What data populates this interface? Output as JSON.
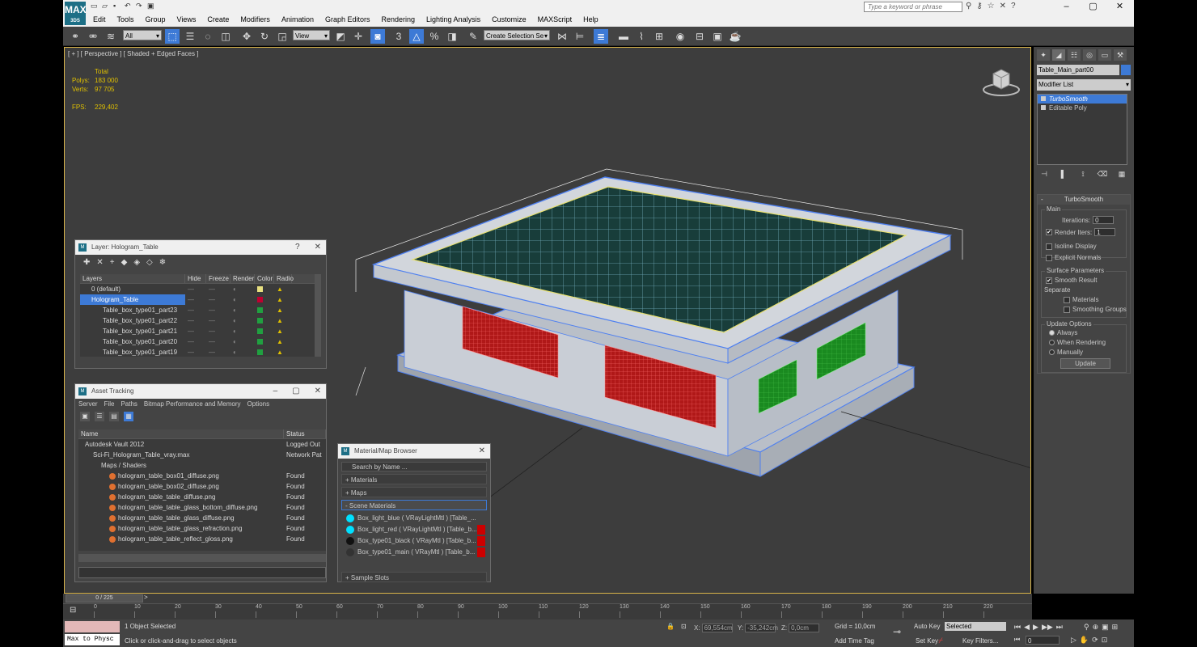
{
  "app": {
    "logo": "MAX",
    "logo_sub": "3DS"
  },
  "menu": [
    "Edit",
    "Tools",
    "Group",
    "Views",
    "Create",
    "Modifiers",
    "Animation",
    "Graph Editors",
    "Rendering",
    "Lighting Analysis",
    "Customize",
    "MAXScript",
    "Help"
  ],
  "search": {
    "placeholder": "Type a keyword or phrase"
  },
  "toolbar": {
    "filter": "All",
    "refcoord": "View",
    "selset": "Create Selection Se"
  },
  "viewport": {
    "label": "[ + ] [ Perspective ] [ Shaded + Edged Faces ]",
    "stats_header": "Total",
    "polys_label": "Polys:",
    "polys": "183 000",
    "verts_label": "Verts:",
    "verts": "97 705",
    "fps_label": "FPS:",
    "fps": "229,402"
  },
  "cmdpanel": {
    "object_name": "Table_Main_part00",
    "modifier_list": "Modifier List",
    "stack": [
      "TurboSmooth",
      "Editable Poly"
    ],
    "rollout_title": "TurboSmooth",
    "main_group": "Main",
    "iterations_label": "Iterations:",
    "iterations": "0",
    "render_iters_label": "Render Iters:",
    "render_iters": "1",
    "isoline": "Isoline Display",
    "explicit_normals": "Explicit Normals",
    "surface_group": "Surface Parameters",
    "smooth_result": "Smooth Result",
    "separate": "Separate",
    "materials": "Materials",
    "smoothing_groups": "Smoothing Groups",
    "update_group": "Update Options",
    "always": "Always",
    "when_rendering": "When Rendering",
    "manually": "Manually",
    "update_btn": "Update"
  },
  "layer_window": {
    "title": "Layer: Hologram_Table",
    "columns": [
      "Layers",
      "Hide",
      "Freeze",
      "Render",
      "Color",
      "Radio"
    ],
    "rows": [
      {
        "name": "0 (default)",
        "color": "#e8e080",
        "sel": false
      },
      {
        "name": "Hologram_Table",
        "color": "#c00030",
        "sel": true
      },
      {
        "name": "Table_box_type01_part23",
        "color": "#20a040",
        "sel": false
      },
      {
        "name": "Table_box_type01_part22",
        "color": "#20a040",
        "sel": false
      },
      {
        "name": "Table_box_type01_part21",
        "color": "#20a040",
        "sel": false
      },
      {
        "name": "Table_box_type01_part20",
        "color": "#20a040",
        "sel": false
      },
      {
        "name": "Table_box_type01_part19",
        "color": "#20a040",
        "sel": false
      }
    ]
  },
  "asset_window": {
    "title": "Asset Tracking",
    "menu": [
      "Server",
      "File",
      "Paths",
      "Bitmap Performance and Memory",
      "Options"
    ],
    "columns": [
      "Name",
      "Status"
    ],
    "rows": [
      {
        "name": "Autodesk Vault 2012",
        "status": "Logged Out",
        "indent": 0
      },
      {
        "name": "Sci-Fi_Hologram_Table_vray.max",
        "status": "Network Pat",
        "indent": 1
      },
      {
        "name": "Maps / Shaders",
        "status": "",
        "indent": 2
      },
      {
        "name": "hologram_table_box01_diffuse.png",
        "status": "Found",
        "indent": 3
      },
      {
        "name": "hologram_table_box02_diffuse.png",
        "status": "Found",
        "indent": 3
      },
      {
        "name": "hologram_table_table_diffuse.png",
        "status": "Found",
        "indent": 3
      },
      {
        "name": "hologram_table_table_glass_bottom_diffuse.png",
        "status": "Found",
        "indent": 3
      },
      {
        "name": "hologram_table_table_glass_diffuse.png",
        "status": "Found",
        "indent": 3
      },
      {
        "name": "hologram_table_table_glass_refraction.png",
        "status": "Found",
        "indent": 3
      },
      {
        "name": "hologram_table_table_reflect_gloss.png",
        "status": "Found",
        "indent": 3
      }
    ]
  },
  "browser_window": {
    "title": "Material/Map Browser",
    "search": "Search by Name ...",
    "sections": [
      "+ Materials",
      "+ Maps",
      "- Scene Materials",
      "+ Sample Slots"
    ],
    "items": [
      {
        "name": "Box_light_blue  ( VRayLightMtl ) [Table_...",
        "color": "#00e0ff"
      },
      {
        "name": "Box_light_red  ( VRayLightMtl ) [Table_b...",
        "color": "#00e0ff"
      },
      {
        "name": "Box_type01_black  ( VRayMtl ) [Table_b...",
        "color": "#111111"
      },
      {
        "name": "Box_type01_main  ( VRayMtl ) [Table_b...",
        "color": "#333333"
      }
    ]
  },
  "timeline": {
    "frame": "0 / 225",
    "ticks": [
      "0",
      "10",
      "20",
      "30",
      "40",
      "50",
      "60",
      "70",
      "80",
      "90",
      "100",
      "110",
      "120",
      "130",
      "140",
      "150",
      "160",
      "170",
      "180",
      "190",
      "200",
      "210",
      "220"
    ]
  },
  "status": {
    "script": "Max to Physc",
    "message": "1 Object Selected",
    "hint": "Click or click-and-drag to select objects",
    "x_label": "X:",
    "x": "69,554cm",
    "y_label": "Y:",
    "y": "-35,242cm",
    "z_label": "Z:",
    "z": "0,0cm",
    "grid": "Grid = 10,0cm",
    "add_time_tag": "Add Time Tag",
    "auto_key": "Auto Key",
    "selected": "Selected",
    "set_key": "Set Key",
    "key_filters": "Key Filters...",
    "frame": "0"
  }
}
